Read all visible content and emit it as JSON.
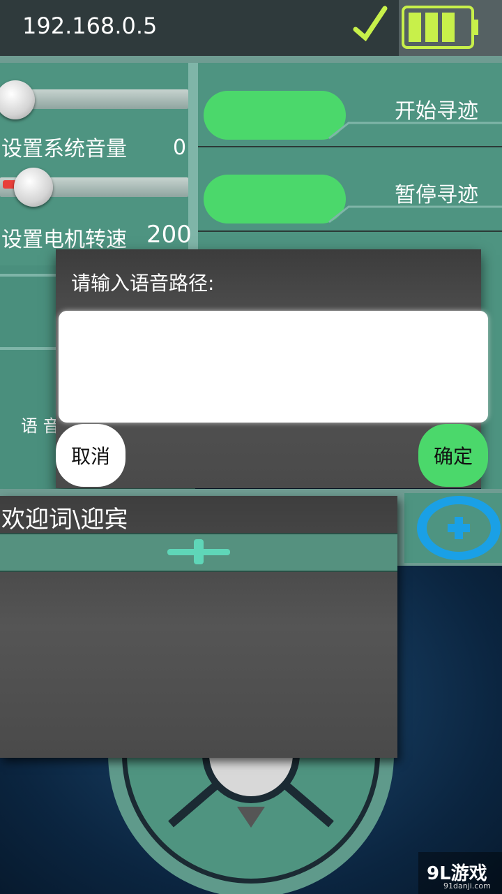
{
  "status_bar": {
    "ip_address": "192.168.0.5",
    "check_icon": "checkmark-icon",
    "battery_icon": "battery-icon"
  },
  "left_panel": {
    "volume_label": "设置系统音量",
    "volume_value": "0",
    "volume_level": 0.0,
    "motor_label": "设置电机转速",
    "motor_value": "200",
    "motor_level": 0.1
  },
  "right_panel": {
    "start_tracking": "开始寻迹",
    "pause_tracking": "暂停寻迹"
  },
  "partial": {
    "hidden_label": "语 音"
  },
  "dialog": {
    "title": "请输入语音路径:",
    "input_value": "",
    "cancel": "取消",
    "confirm": "确定"
  },
  "welcome": {
    "title": "欢迎词\\迎宾",
    "add_icon": "plus-icon"
  },
  "add_button_icon": "plus-circle-icon",
  "dpad_icon": "triangle-down-icon",
  "watermark": {
    "brand": "9L游戏",
    "url": "91danji.com"
  },
  "colors": {
    "toggle_on": "#4bd86b",
    "panel": "#4e9481",
    "accent_blue": "#1aa0e6"
  }
}
